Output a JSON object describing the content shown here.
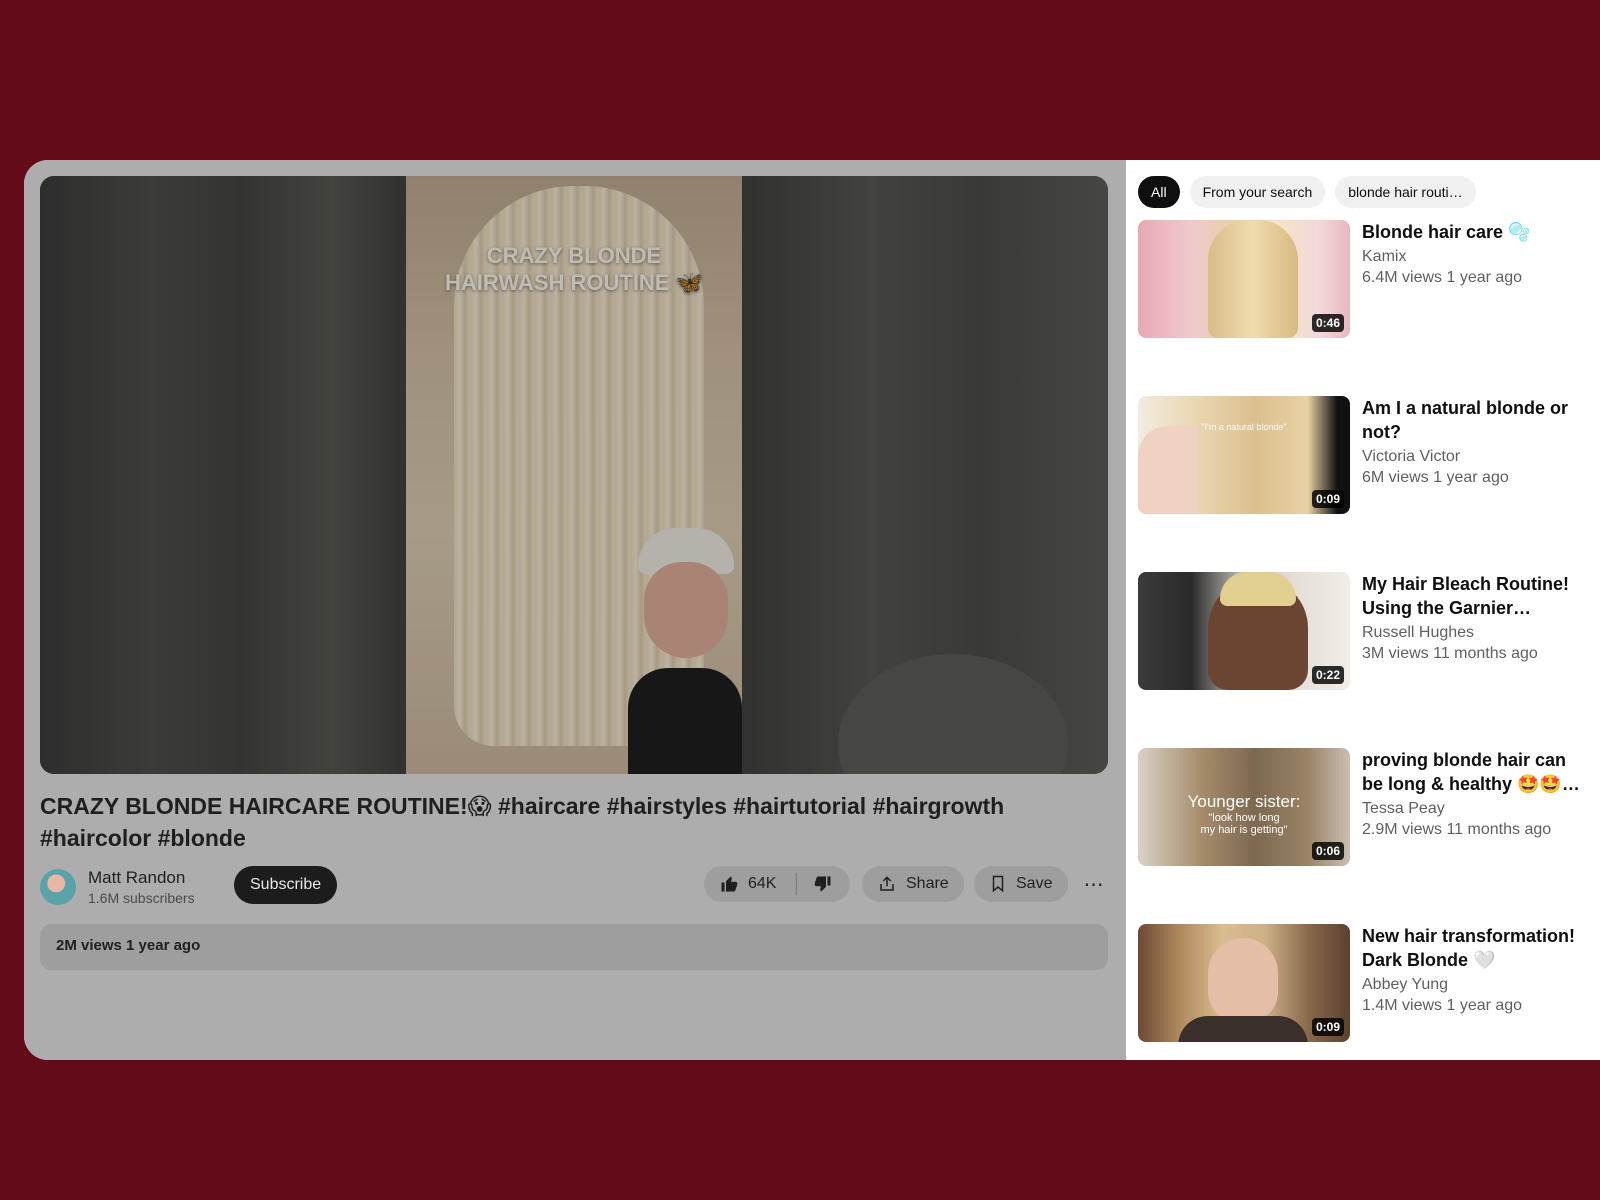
{
  "player": {
    "overlay_caption": "CRAZY BLONDE\nHAIRWASH ROUTINE 🦋"
  },
  "video": {
    "title": "CRAZY BLONDE HAIRCARE ROUTINE!😱  #haircare #hairstyles #hairtutorial #hairgrowth #haircolor #blonde",
    "channel_name": "Matt Randon",
    "subscribers": "1.6M subscribers",
    "subscribe_label": "Subscribe",
    "likes": "64K",
    "share_label": "Share",
    "save_label": "Save",
    "more_label": "⋯",
    "stats": "2M views 1 year ago"
  },
  "sidebar": {
    "chips": [
      {
        "label": "All",
        "active": true
      },
      {
        "label": "From your search",
        "active": false
      },
      {
        "label": "blonde hair routi…",
        "active": false
      }
    ],
    "recommendations": [
      {
        "title": "Blonde hair care 🫧",
        "channel": "Kamix",
        "meta": "6.4M views 1 year ago",
        "duration": "0:46"
      },
      {
        "title": "Am I a natural blonde or not?",
        "channel": "Victoria Victor",
        "meta": "6M views 1 year ago",
        "duration": "0:09",
        "thumb_text": "\"I'm a natural blonde\""
      },
      {
        "title": "My Hair Bleach Routine! Using the Garnier Nutrisse…",
        "channel": "Russell Hughes",
        "meta": "3M views 11 months ago",
        "duration": "0:22"
      },
      {
        "title": "proving blonde hair can be long & healthy 🤩🤩🤩 …",
        "channel": "Tessa Peay",
        "meta": "2.9M views 11 months ago",
        "duration": "0:06",
        "thumb_text_1": "Younger sister:",
        "thumb_text_2": "\"look how long\nmy hair is getting\""
      },
      {
        "title": "New hair transformation! Dark Blonde 🤍",
        "channel": "Abbey Yung",
        "meta": "1.4M views 1 year ago",
        "duration": "0:09"
      }
    ]
  },
  "colors": {
    "page_background": "#630b19",
    "dim_overlay": "#adadad",
    "chip_active": "#0f0f0f"
  }
}
